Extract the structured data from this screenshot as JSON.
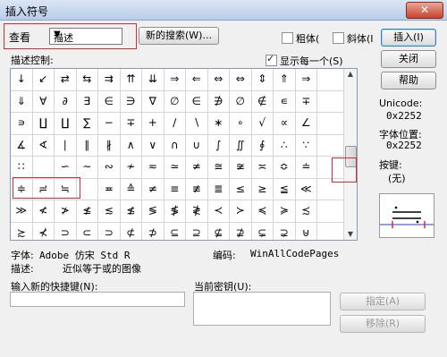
{
  "title": "插入符号",
  "close": "✕",
  "view_label": "查看",
  "view_select": "描述",
  "new_search_button": "新的搜索(W)...",
  "bold_label": "粗体(",
  "italic_label": "斜体(I",
  "insert_button": "插入(I)",
  "close_button": "关闭",
  "help_button": "帮助",
  "description_controls_label": "描述控制:",
  "show_each_label": "显示每一个(S)",
  "unicode_label": "Unicode:",
  "unicode_value": "0x2252",
  "font_pos_label": "字体位置:",
  "font_pos_value": "0x2252",
  "key_label": "按键:",
  "key_value": "(无)",
  "font_label": "字体:",
  "font_value": "Adobe 仿宋 Std R",
  "encoding_label": "编码:",
  "encoding_value": "WinAllCodePages",
  "description_label": "描述:",
  "description_value": "近似等于或的图像",
  "new_shortcut_label": "输入新的快捷键(N):",
  "current_key_label": "当前密钥(U):",
  "assign_button": "指定(A)",
  "remove_button": "移除(R)",
  "rows": [
    [
      "↓",
      "↙",
      "⇄",
      "⇆",
      "⇉",
      "⇈",
      "⇊",
      "⇒",
      "⇐",
      "⇔",
      "⇔",
      "⇕",
      "⇑",
      "⇒"
    ],
    [
      "⇓",
      "∀",
      "∂",
      "∃",
      "∈",
      "∋",
      "∇",
      "∅",
      "∈",
      "∌",
      "∅",
      "∉",
      "∊",
      "∓"
    ],
    [
      "∍",
      "∐",
      "∐",
      "∑",
      "−",
      "∓",
      "+",
      "∕",
      "∖",
      "∗",
      "∘",
      "√",
      "∝",
      "∠"
    ],
    [
      "∡",
      "∢",
      "∣",
      "∥",
      "∦",
      "∧",
      "∨",
      "∩",
      "∪",
      "∫",
      "∬",
      "∮",
      "∴",
      "∵"
    ],
    [
      "∷",
      "",
      "∽",
      "∼",
      "∾",
      "≁",
      "≂",
      "≃",
      "≄",
      "≅",
      "≆",
      "≍",
      "≎",
      "≐"
    ],
    [
      "≑",
      "≓",
      "≒",
      "",
      "≖",
      "≙",
      "≠",
      "≡",
      "≢",
      "≣",
      "≤",
      "≥",
      "≦",
      "≪"
    ],
    [
      "≫",
      "≮",
      "≯",
      "≰",
      "≲",
      "≴",
      "≶",
      "≸",
      "≹",
      "≺",
      "≻",
      "≼",
      "≽",
      "≾"
    ],
    [
      "≿",
      "⊀",
      "⊃",
      "⊂",
      "⊃",
      "⊄",
      "⊅",
      "⊆",
      "⊇",
      "⊈",
      "⊉",
      "⊊",
      "⊋",
      "⊎"
    ]
  ]
}
